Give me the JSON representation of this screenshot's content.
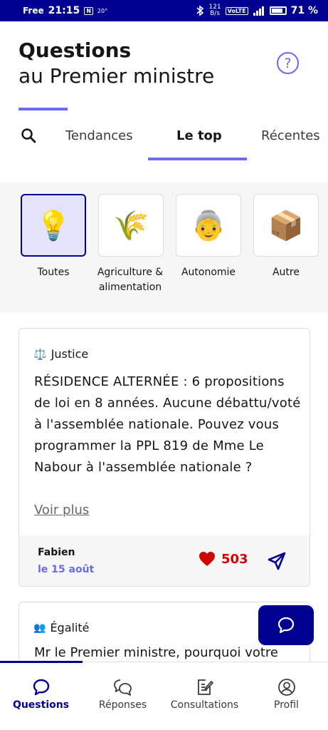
{
  "status_bar": {
    "carrier": "Free",
    "time": "21:15",
    "nfc": "N",
    "temp": "20°",
    "net_speed_top": "121",
    "net_speed_bottom": "B/s",
    "volte": "VoLTE",
    "signal": "4G",
    "battery": "71 %"
  },
  "header": {
    "title_bold": "Questions",
    "title_light": "au Premier ministre",
    "help_icon": "question-circle-icon"
  },
  "tabs": [
    {
      "label": "Tendances"
    },
    {
      "label": "Le top",
      "active": true
    },
    {
      "label": "Récentes"
    }
  ],
  "categories": [
    {
      "label": "Toutes",
      "icon": "💡",
      "selected": true
    },
    {
      "label": "Agriculture & alimentation",
      "icon": "🌾"
    },
    {
      "label": "Autonomie",
      "icon": "👵"
    },
    {
      "label": "Autre",
      "icon": "📦"
    }
  ],
  "card": {
    "tag_icon": "⚖️",
    "tag": "Justice",
    "text": "RÉSIDENCE ALTERNÉE : 6 propositions de loi en 8 années. Aucune débattu/voté à l'assemblée nationale. Pouvez vous programmer la PPL 819 de Mme Le Nabour à l'assemblée nationale ?",
    "voir_plus": "Voir plus",
    "author": "Fabien",
    "date": "le 15 août",
    "likes": "503"
  },
  "card2": {
    "tag_icon": "👥",
    "tag": "Égalité",
    "text": "Mr le Premier ministre, pourquoi votre"
  },
  "bottom_nav": [
    {
      "label": "Questions",
      "icon": "chat-bubble-icon",
      "active": true
    },
    {
      "label": "Réponses",
      "icon": "chat-bubbles-icon"
    },
    {
      "label": "Consultations",
      "icon": "edit-document-icon"
    },
    {
      "label": "Profil",
      "icon": "user-circle-icon"
    }
  ],
  "colors": {
    "primary": "#000091",
    "accent": "#6a6af4",
    "like": "#ce0500"
  }
}
